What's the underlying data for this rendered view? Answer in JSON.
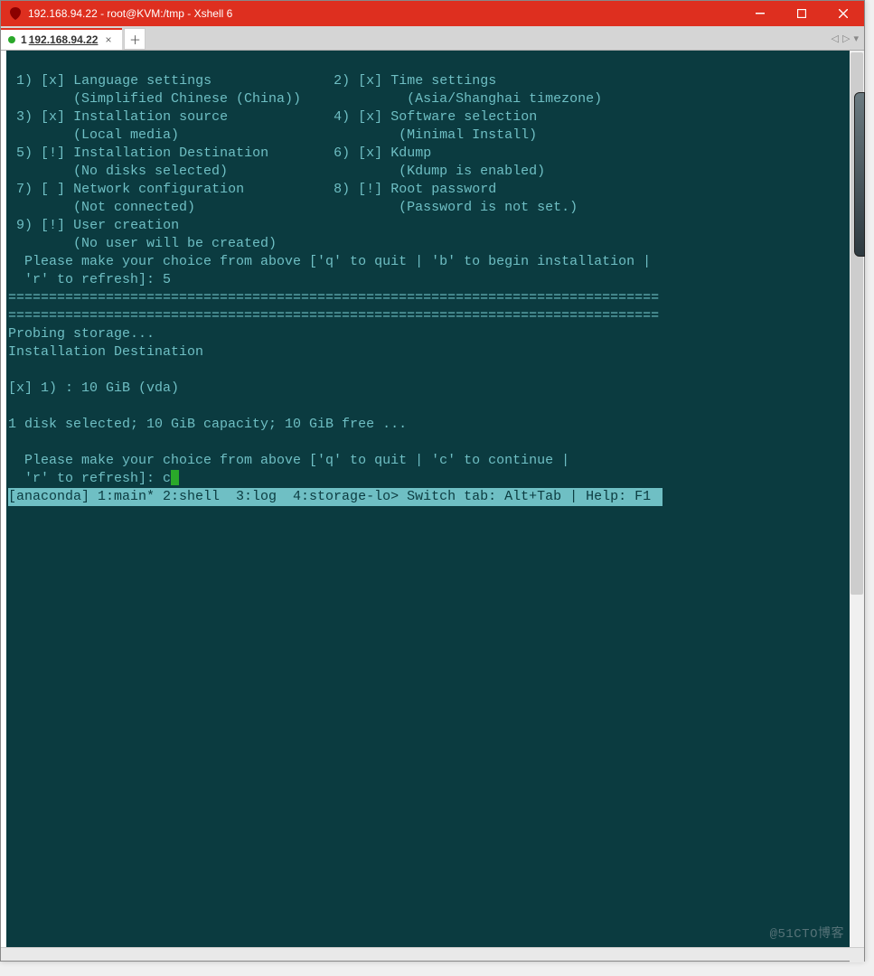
{
  "title": "192.168.94.22 - root@KVM:/tmp - Xshell 6",
  "tab": {
    "num": "1",
    "label": "192.168.94.22"
  },
  "menu": {
    "items": [
      {
        "num": "1",
        "mark": "[x]",
        "title": "Language settings",
        "sub": "(Simplified Chinese (China))"
      },
      {
        "num": "2",
        "mark": "[x]",
        "title": "Time settings",
        "sub": "(Asia/Shanghai timezone)"
      },
      {
        "num": "3",
        "mark": "[x]",
        "title": "Installation source",
        "sub": "(Local media)"
      },
      {
        "num": "4",
        "mark": "[x]",
        "title": "Software selection",
        "sub": "(Minimal Install)"
      },
      {
        "num": "5",
        "mark": "[!]",
        "title": "Installation Destination",
        "sub": "(No disks selected)"
      },
      {
        "num": "6",
        "mark": "[x]",
        "title": "Kdump",
        "sub": "(Kdump is enabled)"
      },
      {
        "num": "7",
        "mark": "[ ]",
        "title": "Network configuration",
        "sub": "(Not connected)"
      },
      {
        "num": "8",
        "mark": "[!]",
        "title": "Root password",
        "sub": "(Password is not set.)"
      },
      {
        "num": "9",
        "mark": "[!]",
        "title": "User creation",
        "sub": "(No user will be created)"
      }
    ],
    "prompt1": "  Please make your choice from above ['q' to quit | 'b' to begin installation |",
    "prompt2": "  'r' to refresh]: 5"
  },
  "divider": "================================================================================",
  "probe": "Probing storage...",
  "dest_header": "Installation Destination",
  "disk_line": "[x] 1) : 10 GiB (vda)",
  "summary": "1 disk selected; 10 GiB capacity; 10 GiB free ...",
  "prompt3": "  Please make your choice from above ['q' to quit | 'c' to continue |",
  "prompt4a": "  'r' to refresh]: c",
  "status_bar": "[anaconda] 1:main* 2:shell  3:log  4:storage-lo> Switch tab: Alt+Tab | Help: F1 ",
  "watermark": "@51CTO博客"
}
